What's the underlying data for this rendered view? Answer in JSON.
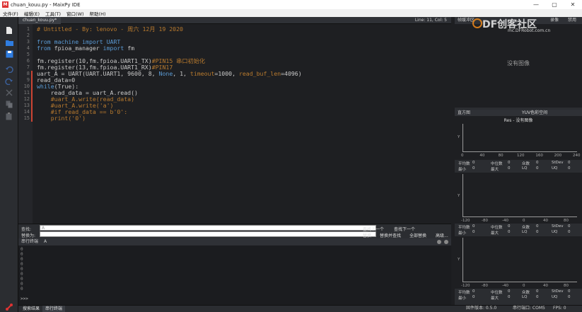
{
  "window": {
    "title": "chuan_kouu.py - MaixPy IDE",
    "controls": [
      "—",
      "▢",
      "✕"
    ]
  },
  "menu": [
    "文件(F)",
    "编辑(E)",
    "工具(T)",
    "窗口(W)",
    "帮助(H)"
  ],
  "editor": {
    "tab_label": "chuan_kouu.py*",
    "cursor_status": "Line: 11, Col: 5",
    "lines": [
      {
        "n": "1",
        "parts": [
          {
            "t": "# Untitled - By: lenovo - 周六 12月 19 2020",
            "c": "c-com"
          }
        ]
      },
      {
        "n": "2",
        "parts": [
          {
            "t": "",
            "c": "c-def"
          }
        ]
      },
      {
        "n": "3",
        "parts": [
          {
            "t": "from ",
            "c": "c-kw"
          },
          {
            "t": "machine ",
            "c": "c-kw"
          },
          {
            "t": "import ",
            "c": "c-kw"
          },
          {
            "t": "UART",
            "c": "c-kw"
          }
        ]
      },
      {
        "n": "4",
        "parts": [
          {
            "t": "from ",
            "c": "c-kw"
          },
          {
            "t": "fpioa_manager ",
            "c": "c-def"
          },
          {
            "t": "import ",
            "c": "c-kw"
          },
          {
            "t": "fm",
            "c": "c-def"
          }
        ]
      },
      {
        "n": "5",
        "parts": [
          {
            "t": "",
            "c": "c-def"
          }
        ]
      },
      {
        "n": "6",
        "parts": [
          {
            "t": "fm.register(10,fm.fpioa.UART1_TX)",
            "c": "c-def"
          },
          {
            "t": "#PIN15 串口初始化",
            "c": "c-com"
          }
        ]
      },
      {
        "n": "7",
        "parts": [
          {
            "t": "fm.register(13,fm.fpioa.UART1_RX)",
            "c": "c-def"
          },
          {
            "t": "#PIN17",
            "c": "c-com"
          }
        ]
      },
      {
        "n": "8",
        "parts": [
          {
            "t": "uart_A = UART(UART.UART1, 9600, 8, ",
            "c": "c-def"
          },
          {
            "t": "None",
            "c": "c-kw"
          },
          {
            "t": ", 1, ",
            "c": "c-def"
          },
          {
            "t": "timeout",
            "c": "c-param"
          },
          {
            "t": "=1000, ",
            "c": "c-def"
          },
          {
            "t": "read_buf_len",
            "c": "c-param"
          },
          {
            "t": "=4096)",
            "c": "c-def"
          }
        ]
      },
      {
        "n": "9",
        "parts": [
          {
            "t": "read_data=0",
            "c": "c-def"
          }
        ]
      },
      {
        "n": "10",
        "parts": [
          {
            "t": "while",
            "c": "c-kw"
          },
          {
            "t": "(True):",
            "c": "c-def"
          }
        ]
      },
      {
        "n": "11",
        "parts": [
          {
            "t": "    read_data = uart_A.read()",
            "c": "c-def"
          }
        ]
      },
      {
        "n": "12",
        "parts": [
          {
            "t": "    #uart_A.write(read_data)",
            "c": "c-com"
          }
        ]
      },
      {
        "n": "13",
        "parts": [
          {
            "t": "    #uart_A.write('a')",
            "c": "c-com"
          }
        ]
      },
      {
        "n": "14",
        "parts": [
          {
            "t": "    #if read_data == b'0':",
            "c": "c-com"
          }
        ]
      },
      {
        "n": "15",
        "parts": [
          {
            "t": "    print('0')",
            "c": "c-com"
          }
        ]
      }
    ]
  },
  "find": {
    "find_label": "查找:",
    "find_value": "A",
    "replace_label": "替换为:",
    "find_prev": "查找上一个",
    "find_next": "查找下一个",
    "replace": "替换",
    "replace_find": "替换并查找",
    "replace_all": "全部替换",
    "advanced": "高级..."
  },
  "terminal": {
    "header": "串行终端",
    "header_value": "A",
    "lines": [
      "0",
      "0",
      "0",
      "0",
      "0",
      "0",
      "0",
      "0",
      "0"
    ],
    "prompt": ">>>"
  },
  "bottom_tabs": [
    "搜索结果",
    "串行终端"
  ],
  "framebuffer": {
    "header": "帧缓冲区",
    "record": "录像",
    "disable": "禁用",
    "no_image": "没有图像"
  },
  "histogram": {
    "header": "直方图",
    "colorspace": "YUV色彩空间",
    "plot1_title": "Res - 没有图像",
    "plot1_x": [
      "0",
      "40",
      "80",
      "120",
      "160",
      "200",
      "240"
    ],
    "plot23_x": [
      "-120",
      "-80",
      "-40",
      "0",
      "40",
      "80"
    ],
    "ylabel": "Y",
    "stats1": [
      [
        "平均数",
        "0",
        "中位数",
        "0",
        "众数",
        "0",
        "StDev",
        "0"
      ],
      [
        "最小",
        "0",
        "最大",
        "0",
        "LQ",
        "0",
        "UQ",
        "0"
      ]
    ],
    "stats2": [
      [
        "平均数",
        "0",
        "中位数",
        "0",
        "众数",
        "0",
        "StDev",
        "0"
      ],
      [
        "最小",
        "0",
        "最大",
        "0",
        "LQ",
        "0",
        "UQ",
        "0"
      ]
    ],
    "stats3": [
      [
        "平均数",
        "0",
        "中位数",
        "0",
        "众数",
        "0",
        "StDev",
        "0"
      ],
      [
        "最小",
        "0",
        "最大",
        "0",
        "LQ",
        "0",
        "UQ",
        "0"
      ]
    ]
  },
  "status": {
    "firmware": "固件版本: 0.5.0",
    "port": "串行端口: COM5",
    "fps": "FPS: 0"
  },
  "watermark": {
    "brand": "DF创客社区",
    "url": "mc.DFRobot.com.cn"
  },
  "colors": {
    "accent_blue": "#2f7de1",
    "comment": "#b87a2e",
    "keyword": "#5b9bd5",
    "disconnect_red": "#d33"
  }
}
